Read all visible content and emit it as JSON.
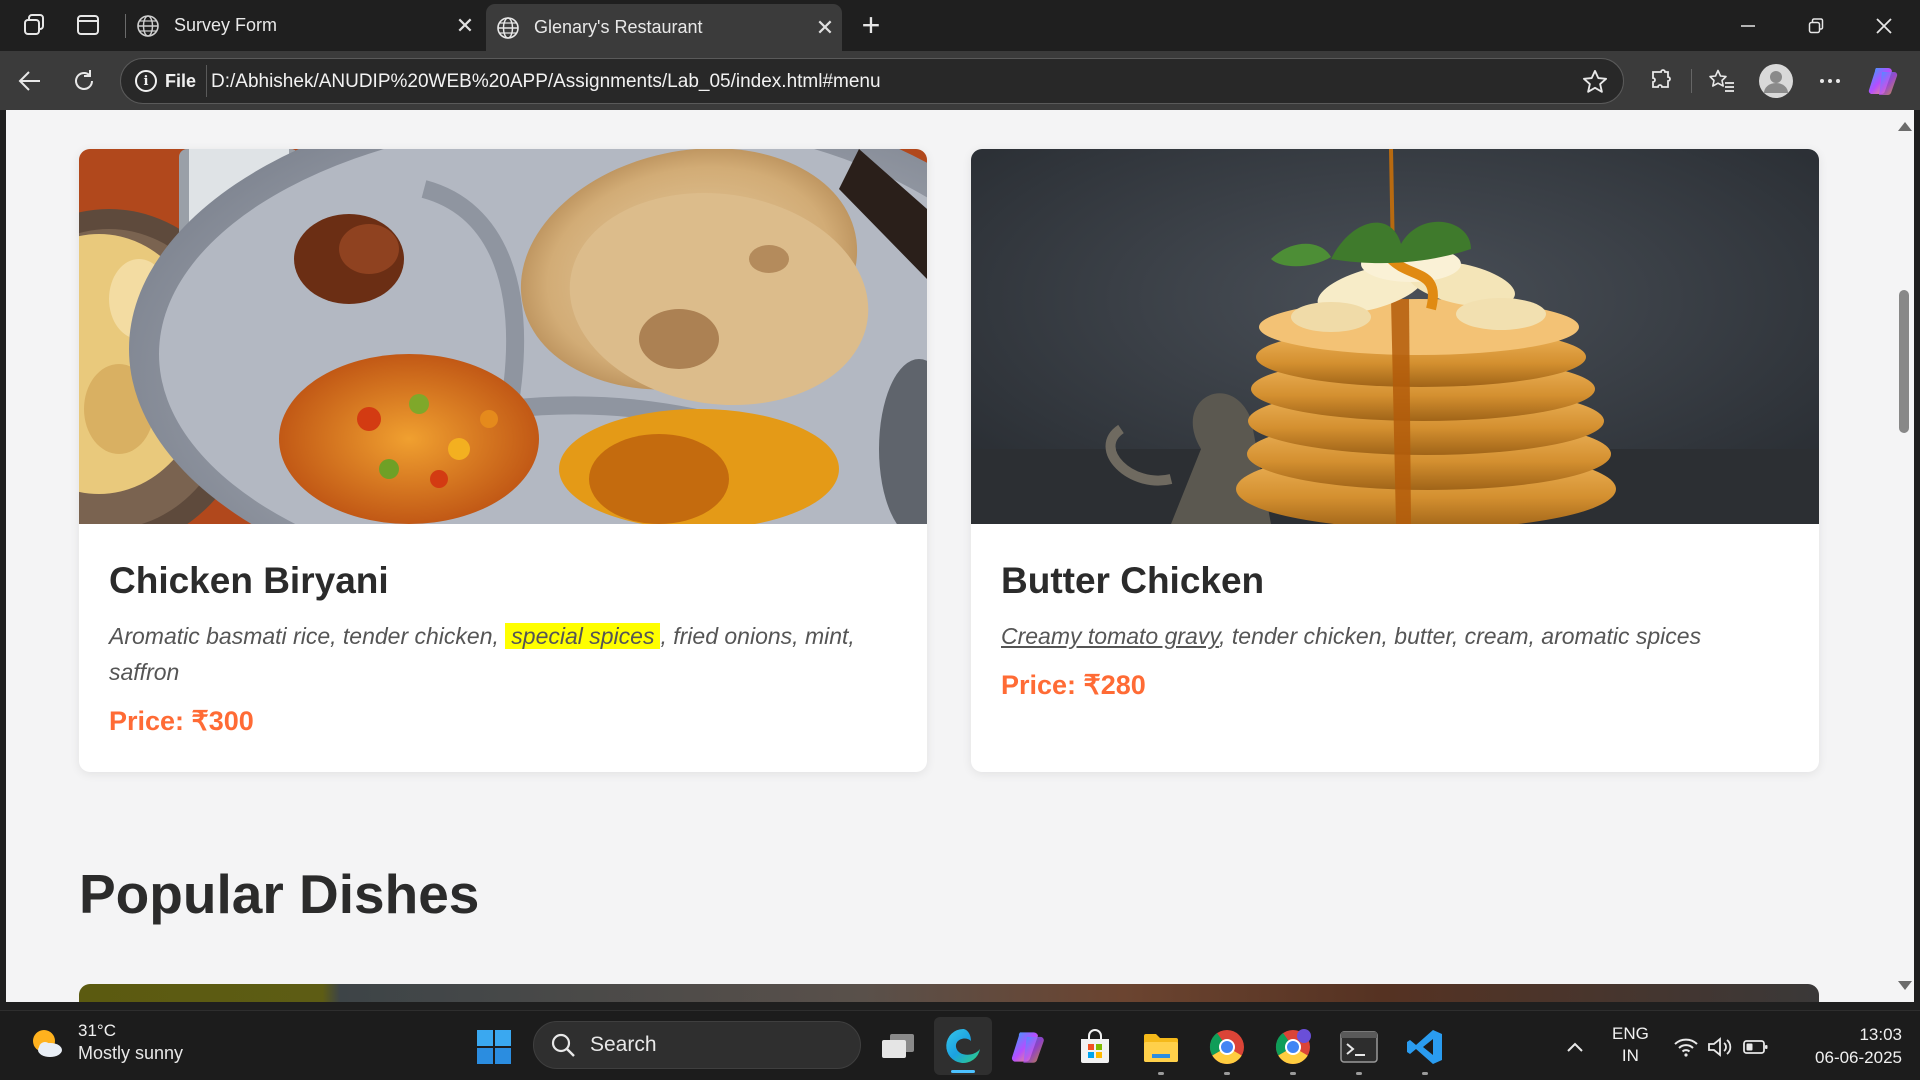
{
  "browser": {
    "tabs": [
      {
        "label": "Survey Form",
        "active": false
      },
      {
        "label": "Glenary's Restaurant",
        "active": true
      }
    ],
    "address": {
      "scheme_chip": "File",
      "url": "D:/Abhishek/ANUDIP%20WEB%20APP/Assignments/Lab_05/index.html#menu"
    }
  },
  "page": {
    "menu_cards": [
      {
        "title": "Chicken Biryani",
        "desc_before": "Aromatic basmati rice, tender chicken, ",
        "desc_highlight": "special spices",
        "desc_after": ", fried onions, mint, saffron",
        "price": "Price: ₹300"
      },
      {
        "title": "Butter Chicken",
        "desc_underlined": "Creamy tomato gravy",
        "desc_after": ", tender chicken, butter, cream, aromatic spices",
        "price": "Price: ₹280"
      }
    ],
    "section_title": "Popular Dishes",
    "colors": {
      "price": "#ff6b35",
      "highlight": "#ffff00",
      "heading": "#2b2b2b",
      "background": "#f4f4f5"
    }
  },
  "taskbar": {
    "weather": {
      "temp": "31°C",
      "condition": "Mostly sunny"
    },
    "search_placeholder": "Search",
    "language": {
      "line1": "ENG",
      "line2": "IN"
    },
    "clock": {
      "time": "13:03",
      "date": "06-06-2025"
    }
  }
}
